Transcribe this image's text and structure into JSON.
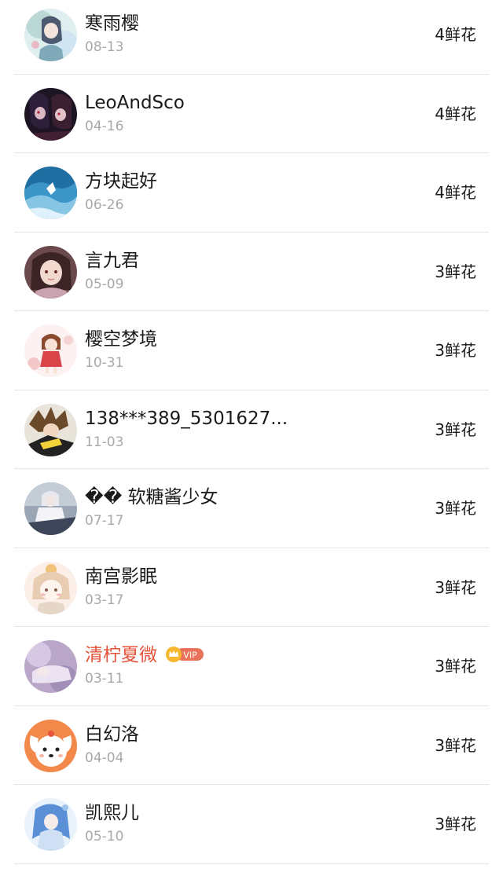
{
  "list": {
    "items": [
      {
        "name": "寒雨樱",
        "date": "08-13",
        "flowers": "4鲜花",
        "vip": false,
        "avatar": "anime-girl-teal-avatar"
      },
      {
        "name": "LeoAndSco",
        "date": "04-16",
        "flowers": "4鲜花",
        "vip": false,
        "avatar": "dark-anime-duo-avatar"
      },
      {
        "name": "方块起好",
        "date": "06-26",
        "flowers": "4鲜花",
        "vip": false,
        "avatar": "ocean-wave-avatar"
      },
      {
        "name": "言九君",
        "date": "05-09",
        "flowers": "3鲜花",
        "vip": false,
        "avatar": "anime-girl-brown-hair-avatar"
      },
      {
        "name": "樱空梦境",
        "date": "10-31",
        "flowers": "3鲜花",
        "vip": false,
        "avatar": "chibi-girl-red-dress-avatar"
      },
      {
        "name": "138***389_5301627...",
        "date": "11-03",
        "flowers": "3鲜花",
        "vip": false,
        "avatar": "anime-boy-spiky-hair-avatar"
      },
      {
        "name": "�� 软糖酱少女",
        "date": "07-17",
        "flowers": "3鲜花",
        "vip": false,
        "avatar": "anime-girl-white-avatar"
      },
      {
        "name": "南宫影眠",
        "date": "03-17",
        "flowers": "3鲜花",
        "vip": false,
        "avatar": "chibi-girl-beige-avatar"
      },
      {
        "name": "清柠夏微",
        "date": "03-11",
        "flowers": "3鲜花",
        "vip": true,
        "vip_label": "VIP",
        "avatar": "lavender-sleeping-avatar"
      },
      {
        "name": "白幻洛",
        "date": "04-04",
        "flowers": "3鲜花",
        "vip": false,
        "avatar": "cartoon-dog-orange-avatar"
      },
      {
        "name": "凯熙儿",
        "date": "05-10",
        "flowers": "3鲜花",
        "vip": false,
        "avatar": "anime-girl-blue-hair-avatar"
      }
    ]
  },
  "colors": {
    "vip_name": "#e5533a",
    "vip_badge": "#e8735a",
    "crown": "#f5b82e",
    "date": "#a8a8a8",
    "divider": "#e6e6e6"
  }
}
